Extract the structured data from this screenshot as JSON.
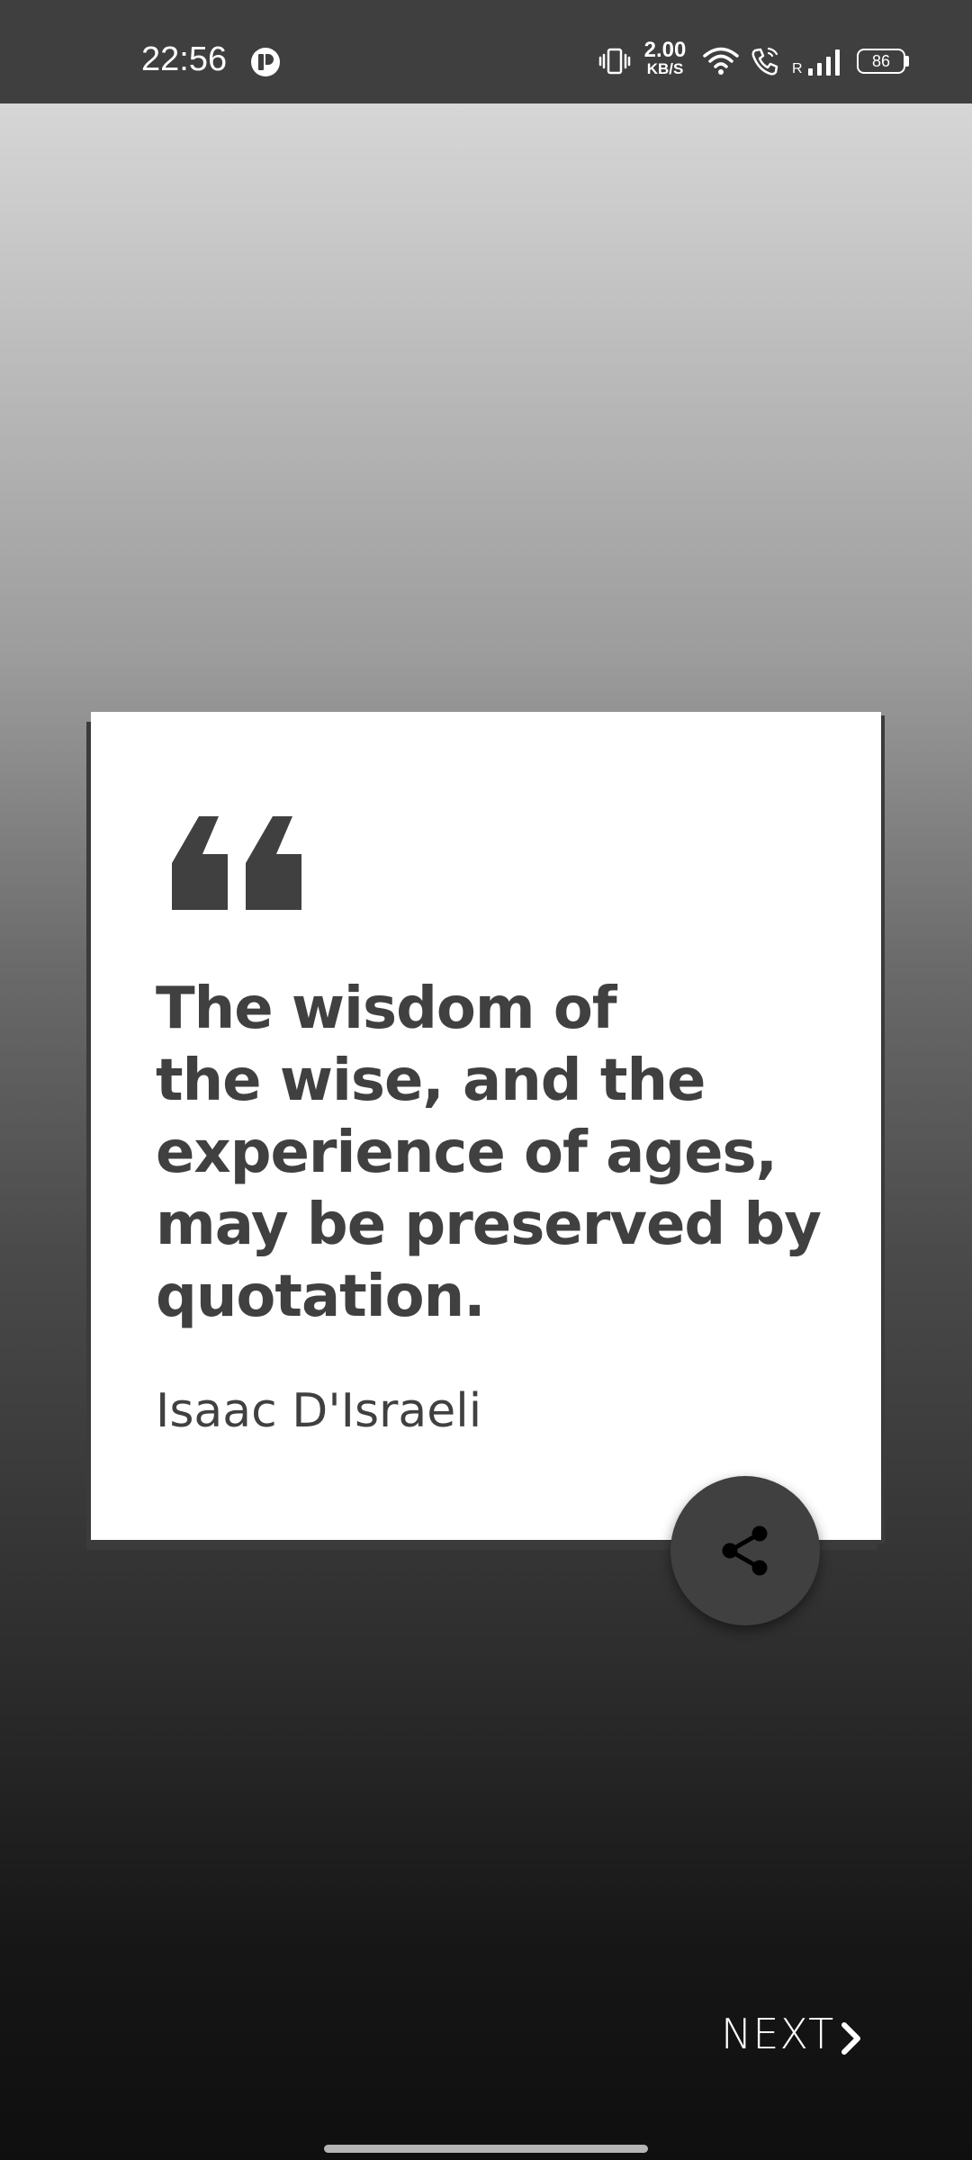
{
  "status_bar": {
    "time": "22:56",
    "net_speed_value": "2.00",
    "net_speed_unit": "KB/S",
    "roaming_indicator": "R",
    "battery_level": "86",
    "icons": [
      "notification-app-icon",
      "vibrate-icon",
      "wifi-icon",
      "wifi-calling-icon",
      "signal-icon",
      "battery-icon"
    ]
  },
  "quote": {
    "text": "The wisdom of\nthe wise, and the\nexperience of ages,\nmay be preserved by\nquotation.",
    "author": "Isaac D'Israeli",
    "icon": "quote-mark-icon"
  },
  "actions": {
    "share_icon": "share-icon",
    "next_label": "NEXT",
    "next_icon": "chevron-right-icon"
  },
  "colors": {
    "status_bar": "#3f3f3f",
    "card": "#ffffff",
    "text": "#404040",
    "fab": "#404040"
  }
}
